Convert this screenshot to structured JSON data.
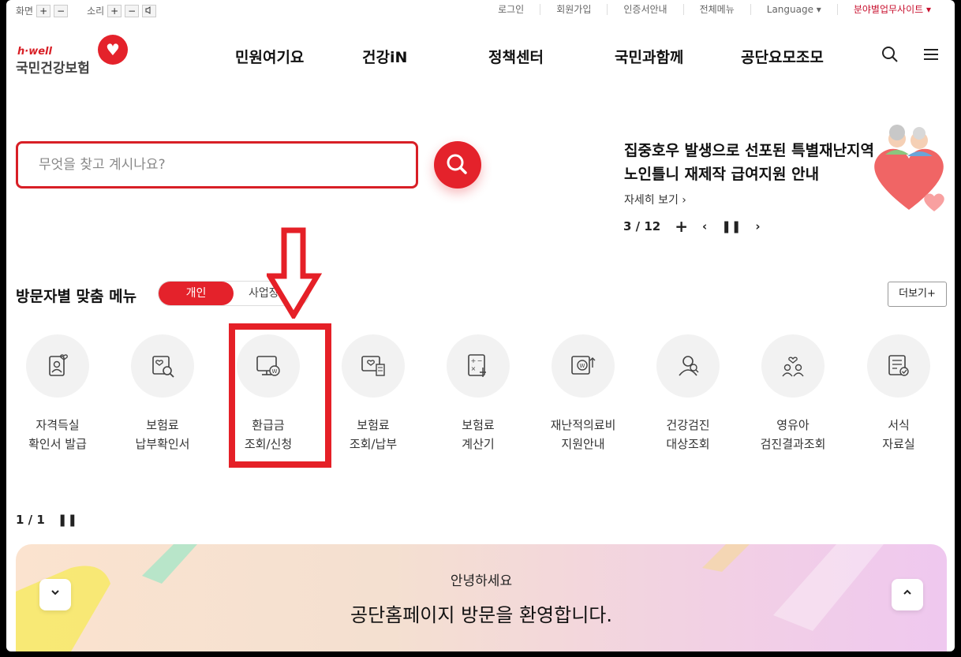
{
  "util": {
    "screen_label": "화면",
    "sound_label": "소리",
    "plus": "+",
    "minus": "−",
    "links": [
      "로그인",
      "회원가입",
      "인증서안내",
      "전체메뉴"
    ],
    "language": "Language ▾",
    "business_site": "분야별업무사이트 ▾"
  },
  "logo": {
    "brand": "h·well",
    "name": "국민건강보험"
  },
  "nav": [
    "민원여기요",
    "건강iN",
    "정책센터",
    "국민과함께",
    "공단요모조모"
  ],
  "search": {
    "placeholder": "무엇을 찾고 계시나요?"
  },
  "banner": {
    "title_line1": "집중호우 발생으로 선포된 특별재난지역",
    "title_line2": "노인틀니 재제작 급여지원 안내",
    "more": "자세히 보기  ›",
    "counter": "3 / 12",
    "plus": "+"
  },
  "visitor_menu": {
    "title": "방문자별 맞춤 메뉴",
    "tab_individual": "개인",
    "tab_business": "사업장",
    "more": "더보기+",
    "items": [
      {
        "line1": "자격득실",
        "line2": "확인서 발급",
        "icon": "certificate-icon"
      },
      {
        "line1": "보험료",
        "line2": "납부확인서",
        "icon": "document-search-icon"
      },
      {
        "line1": "환급금",
        "line2": "조회/신청",
        "icon": "refund-monitor-icon"
      },
      {
        "line1": "보험료",
        "line2": "조회/납부",
        "icon": "payment-card-icon"
      },
      {
        "line1": "보험료",
        "line2": "계산기",
        "icon": "calculator-icon"
      },
      {
        "line1": "재난적의료비",
        "line2": "지원안내",
        "icon": "medical-support-icon"
      },
      {
        "line1": "건강검진",
        "line2": "대상조회",
        "icon": "health-checkup-icon"
      },
      {
        "line1": "영유아",
        "line2": "검진결과조회",
        "icon": "child-checkup-icon"
      },
      {
        "line1": "서식",
        "line2": "자료실",
        "icon": "forms-icon"
      }
    ],
    "pager": "1 / 1"
  },
  "welcome": {
    "greeting": "안녕하세요",
    "message": "공단홈페이지 방문을 환영합니다."
  },
  "colors": {
    "accent": "#e4222b",
    "annotation": "#e52027"
  }
}
